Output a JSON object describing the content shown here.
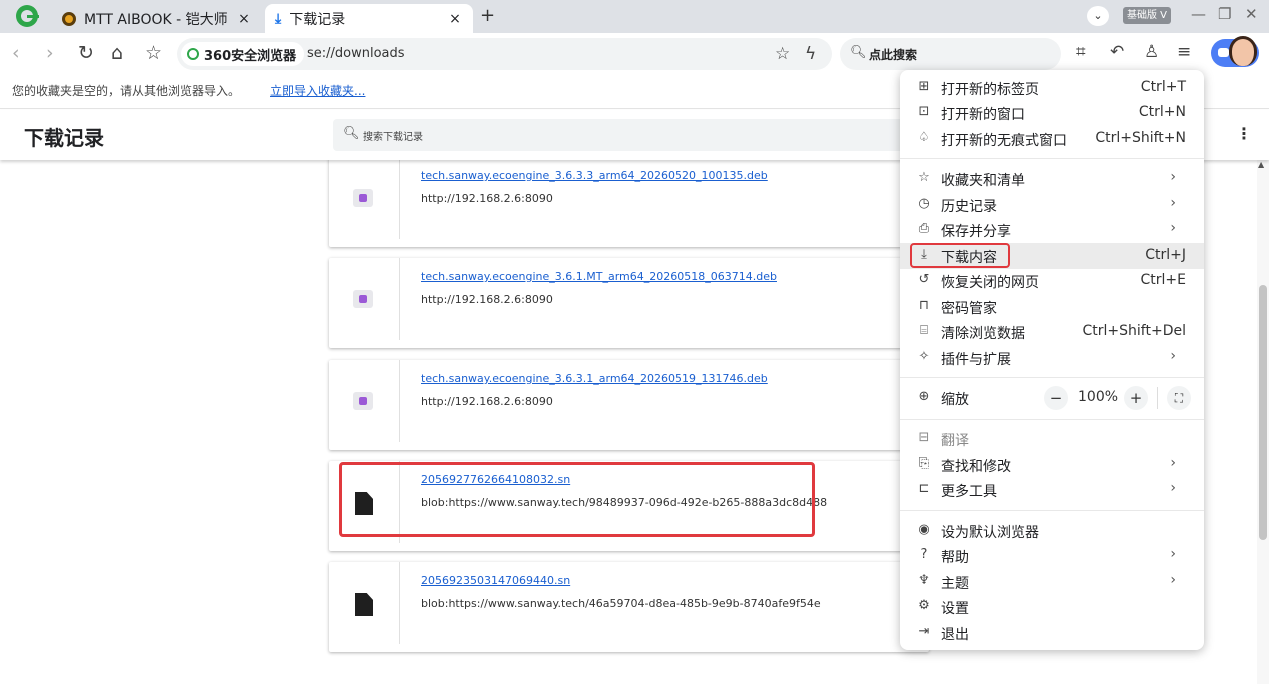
{
  "tabs": [
    {
      "title": "MTT AIBOOK - 铠大师",
      "close": "×"
    },
    {
      "title": "下载记录",
      "close": "×"
    }
  ],
  "tabbar": {
    "new_tab": "+",
    "version_badge": "基础版 V",
    "minimize": "—",
    "restore": "❐",
    "close": "✕",
    "chevron": "⌄"
  },
  "toolbar": {
    "site_name": "360安全浏览器",
    "url": "se://downloads",
    "search_placeholder": "点此搜索"
  },
  "bookmarks": {
    "empty_text": "您的收藏夹是空的，请从其他浏览器导入。",
    "import_link": "立即导入收藏夹..."
  },
  "downloads": {
    "title": "下载记录",
    "search_placeholder": "搜索下载记录",
    "items": [
      {
        "name": "tech.sanway.ecoengine_3.6.3.3_arm64_20260520_100135.deb",
        "url": "http://192.168.2.6:8090",
        "icon": "package-icon"
      },
      {
        "name": "tech.sanway.ecoengine_3.6.1.MT_arm64_20260518_063714.deb",
        "url": "http://192.168.2.6:8090",
        "icon": "package-icon"
      },
      {
        "name": "tech.sanway.ecoengine_3.6.3.1_arm64_20260519_131746.deb",
        "url": "http://192.168.2.6:8090",
        "icon": "package-icon"
      },
      {
        "name": "2056927762664108032.sn",
        "url": "blob:https://www.sanway.tech/98489937-096d-492e-b265-888a3dc8d488",
        "icon": "file-icon"
      },
      {
        "name": "2056923503147069440.sn",
        "url": "blob:https://www.sanway.tech/46a59704-d8ea-485b-9e9b-8740afe9f54e",
        "icon": "file-icon"
      }
    ]
  },
  "menu": {
    "new_tab": {
      "label": "打开新的标签页",
      "shortcut": "Ctrl+T"
    },
    "new_window": {
      "label": "打开新的窗口",
      "shortcut": "Ctrl+N"
    },
    "incognito": {
      "label": "打开新的无痕式窗口",
      "shortcut": "Ctrl+Shift+N"
    },
    "bookmarks": {
      "label": "收藏夹和清单"
    },
    "history": {
      "label": "历史记录"
    },
    "save_share": {
      "label": "保存并分享"
    },
    "downloads": {
      "label": "下载内容",
      "shortcut": "Ctrl+J"
    },
    "restore_closed": {
      "label": "恢复关闭的网页",
      "shortcut": "Ctrl+E"
    },
    "passwords": {
      "label": "密码管家"
    },
    "clear_data": {
      "label": "清除浏览数据",
      "shortcut": "Ctrl+Shift+Del"
    },
    "extensions": {
      "label": "插件与扩展"
    },
    "zoom": {
      "label": "缩放",
      "value": "100%",
      "minus": "−",
      "plus": "+"
    },
    "translate": {
      "label": "翻译"
    },
    "find": {
      "label": "查找和修改"
    },
    "more_tools": {
      "label": "更多工具"
    },
    "default_browser": {
      "label": "设为默认浏览器"
    },
    "help": {
      "label": "帮助"
    },
    "theme": {
      "label": "主题"
    },
    "settings": {
      "label": "设置"
    },
    "exit": {
      "label": "退出"
    },
    "arrow": "›"
  },
  "colors": {
    "accent": "#1a73e8",
    "highlight": "#e0393e",
    "tabbar_bg": "#dee1e6"
  }
}
